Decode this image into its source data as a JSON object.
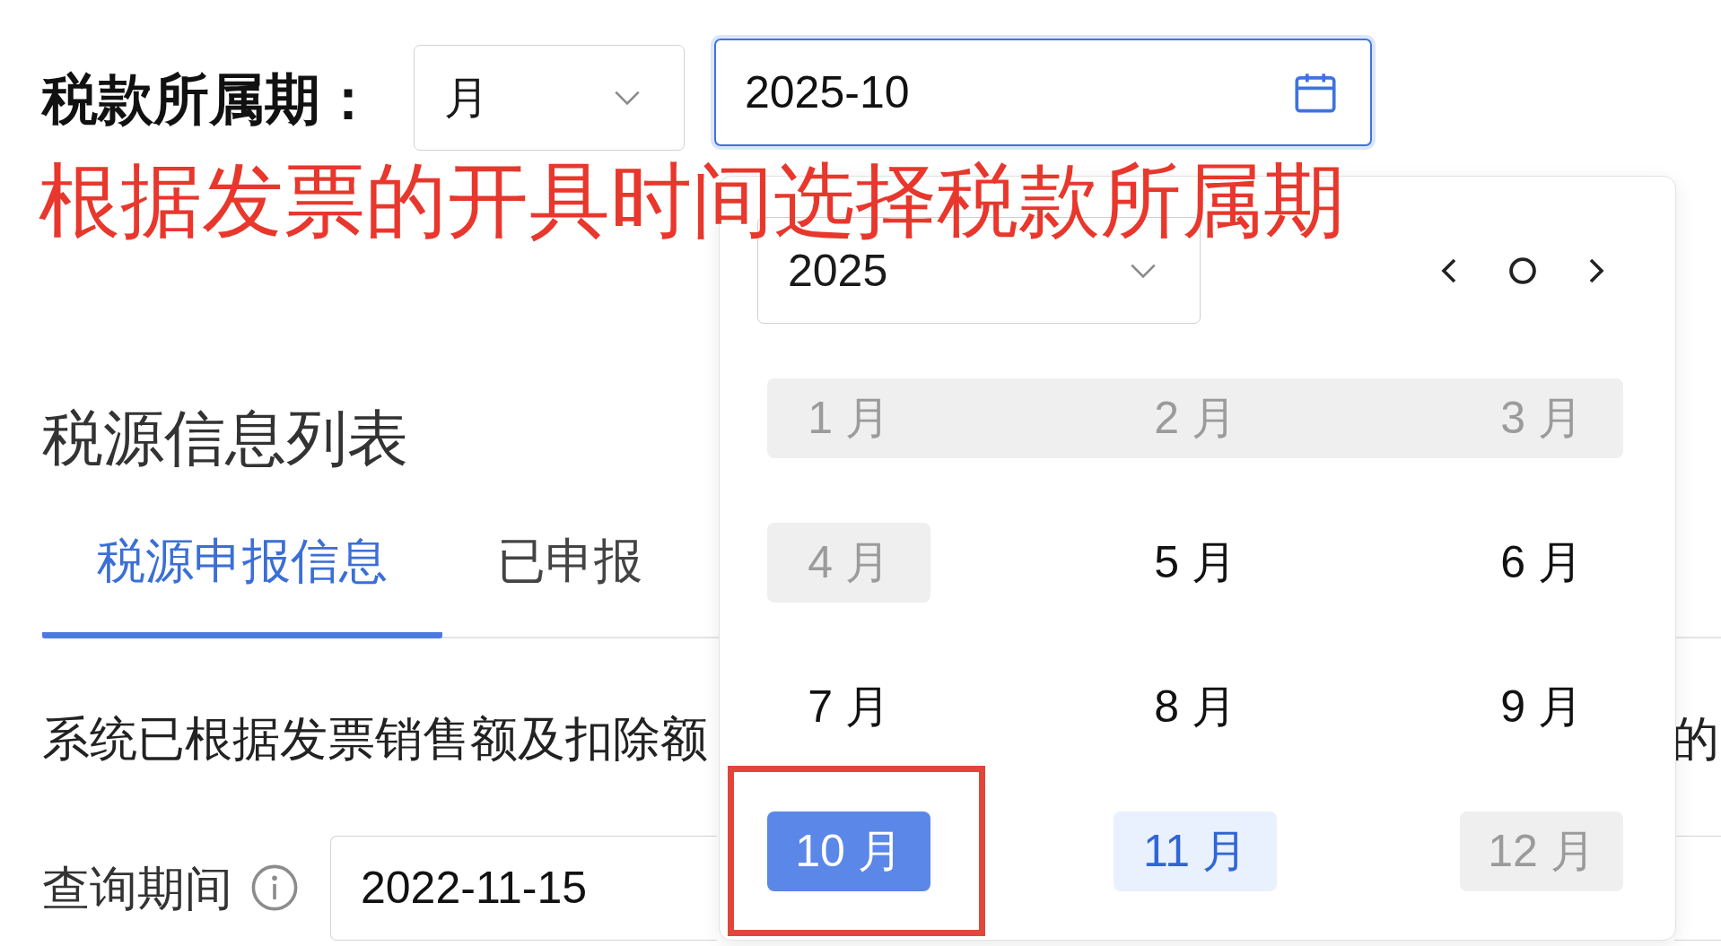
{
  "filter": {
    "label": "税款所属期：",
    "period_select": {
      "value": "月"
    },
    "period_field": {
      "value": "2025-10",
      "focused": true
    }
  },
  "annotation": {
    "text": "根据发票的开具时间选择税款所属期"
  },
  "section_title": "税源信息列表",
  "tabs": [
    {
      "label": "税源申报信息",
      "selected": true
    },
    {
      "label": "已申报",
      "selected": false
    }
  ],
  "notice": {
    "visible_start": "系统已根据发票销售额及扣除额",
    "visible_end": "的"
  },
  "query": {
    "label": "查询期间",
    "start_date": {
      "value": "2022-11-15"
    }
  },
  "month_picker": {
    "year_select": {
      "value": "2025"
    },
    "months": [
      {
        "label": "1 月",
        "selected": false,
        "disabled": true,
        "today": false,
        "framed": false
      },
      {
        "label": "2 月",
        "selected": false,
        "disabled": true,
        "today": false,
        "framed": false
      },
      {
        "label": "3 月",
        "selected": false,
        "disabled": true,
        "today": false,
        "framed": false
      },
      {
        "label": "4 月",
        "selected": false,
        "disabled": true,
        "today": false,
        "framed": false
      },
      {
        "label": "5 月",
        "selected": false,
        "disabled": false,
        "today": false,
        "framed": false
      },
      {
        "label": "6 月",
        "selected": false,
        "disabled": false,
        "today": false,
        "framed": false
      },
      {
        "label": "7 月",
        "selected": false,
        "disabled": false,
        "today": false,
        "framed": false
      },
      {
        "label": "8 月",
        "selected": false,
        "disabled": false,
        "today": false,
        "framed": false
      },
      {
        "label": "9 月",
        "selected": false,
        "disabled": false,
        "today": false,
        "framed": false
      },
      {
        "label": "10 月",
        "selected": true,
        "disabled": false,
        "today": false,
        "framed": true
      },
      {
        "label": "11 月",
        "selected": false,
        "disabled": false,
        "today": true,
        "framed": false
      },
      {
        "label": "12 月",
        "selected": false,
        "disabled": true,
        "today": false,
        "framed": false
      }
    ]
  }
}
